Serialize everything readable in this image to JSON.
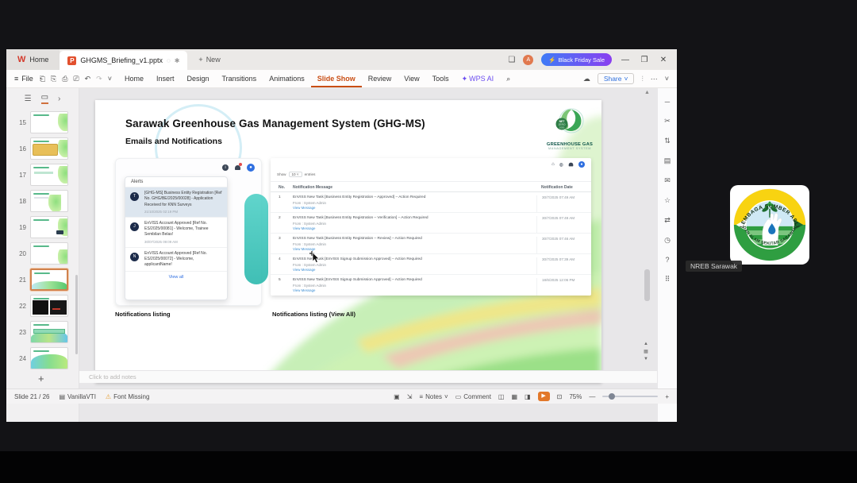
{
  "meeting": {
    "participant_name": "NREB Sarawak",
    "logo_text_top": "LEMBAGA SUMBER ASLI",
    "logo_text_bottom": "DAN ALAM SEKITAR SARAWAK"
  },
  "titlebar": {
    "home_tab": "Home",
    "doc_tab": "GHGMS_Briefing_v1.pptx",
    "new_tab": "New",
    "promo": "Black Friday Sale"
  },
  "menu": {
    "file": "File",
    "items": [
      "Home",
      "Insert",
      "Design",
      "Transitions",
      "Animations",
      "Slide Show",
      "Review",
      "View",
      "Tools"
    ],
    "ai": "WPS AI",
    "share": "Share"
  },
  "slide_panel": {
    "numbers": [
      "15",
      "16",
      "17",
      "18",
      "19",
      "20",
      "21",
      "22",
      "23",
      "24"
    ]
  },
  "slide": {
    "title": "Sarawak Greenhouse Gas Management System (GHG-MS)",
    "subtitle": "Emails and Notifications",
    "logo": {
      "badge": "NET ZERO 2050",
      "line1": "GREENHOUSE GAS",
      "line2": "MANAGEMENT SYSTEM"
    },
    "alerts": {
      "title": "Alerts",
      "view_all": "View all",
      "items": [
        {
          "avatar": "T",
          "text": "[GHG-MS] Business Entity Registration [Ref No. GHG/BE/2025/00028] - Application Received for KNN Surveys",
          "date": "21/10/2025 02:19 PM"
        },
        {
          "avatar": "J",
          "text": "EnVISS Account Approved [Ref No. ES/2025/00081] - Welcome, Trainee Sembilan Belas!",
          "date": "30/07/2025 09:09 AM"
        },
        {
          "avatar": "N",
          "text": "EnVISS Account Approved [Ref No. ES/2025/00072] - Welcome, applicantName!",
          "date": ""
        }
      ]
    },
    "table": {
      "show": "Show",
      "show_value": "10",
      "entries": "entries",
      "col_no": "No.",
      "col_msg": "Notification Message",
      "col_date": "Notification Date",
      "from": "From : System Admin",
      "view_message": "View Message",
      "rows": [
        {
          "no": "1",
          "message": "EnVISS New Task [Business Entity Registration – Approved] – Action Required",
          "date": "30/7/2025 07:49 AM"
        },
        {
          "no": "2",
          "message": "EnVISS New Task [Business Entity Registration – Verification] – Action Required",
          "date": "30/7/2025 07:49 AM"
        },
        {
          "no": "3",
          "message": "EnVISS New Task [Business Entity Registration – Review] – Action Required",
          "date": "30/7/2025 07:46 AM"
        },
        {
          "no": "4",
          "message": "EnVISS New Task [EnVISS Signup Submission Approved] – Action Required",
          "date": "30/7/2025 07:39 AM"
        },
        {
          "no": "5",
          "message": "EnVISS New Task [EnVISS Signup Submission Approved] – Action Required",
          "date": "18/6/2025 12:06 PM"
        }
      ]
    },
    "caption_left": "Notifications listing",
    "caption_right": "Notifications listing (View All)"
  },
  "notes": {
    "placeholder": "Click to add notes"
  },
  "statusbar": {
    "slide_counter": "Slide 21 / 26",
    "theme": "VanillaVTI",
    "font_missing": "Font Missing",
    "notes": "Notes",
    "comment": "Comment",
    "zoom": "75%"
  }
}
